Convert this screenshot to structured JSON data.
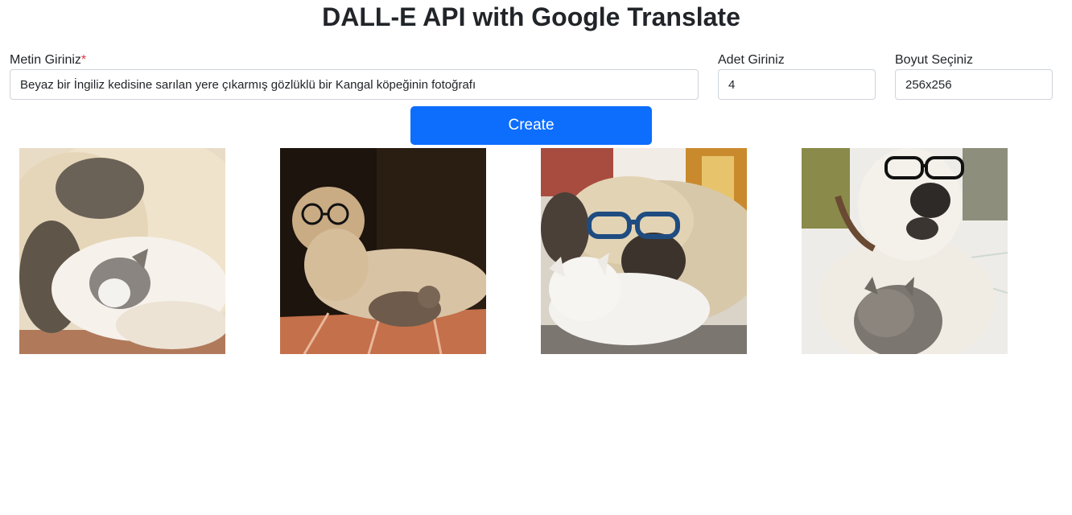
{
  "header": {
    "title": "DALL-E API with Google Translate"
  },
  "form": {
    "text_label": "Metin Giriniz",
    "required_mark": "*",
    "text_value": "Beyaz bir İngiliz kedisine sarılan yere çıkarmış gözlüklü bir Kangal köpeğinin fotoğrafı",
    "count_label": "Adet Giriniz",
    "count_value": "4",
    "size_label": "Boyut Seçiniz",
    "size_value": "256x256",
    "create_label": "Create"
  },
  "results": {
    "images": [
      {
        "icon": "dog-hugging-cat-image"
      },
      {
        "icon": "dog-with-glasses-and-cat-image"
      },
      {
        "icon": "dog-with-blue-glasses-and-cat-image"
      },
      {
        "icon": "dog-with-glasses-sitting-with-cat-image"
      }
    ]
  },
  "colors": {
    "primary": "#0d6efd",
    "required": "#dc3545",
    "text": "#212529",
    "border": "#ced4da"
  }
}
